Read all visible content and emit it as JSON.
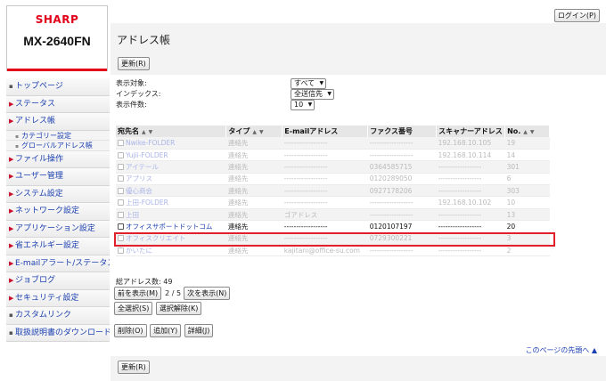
{
  "brand": {
    "logo": "SHARP",
    "model": "MX-2640FN"
  },
  "header": {
    "login_label": "ログイン(P)",
    "title": "アドレス帳",
    "refresh_label": "更新(R)"
  },
  "sidebar": {
    "items": [
      {
        "label": "トップページ",
        "marker": "gray"
      },
      {
        "label": "ステータス",
        "marker": "red"
      },
      {
        "label": "アドレス帳",
        "marker": "red"
      },
      {
        "label": "ファイル操作",
        "marker": "red"
      },
      {
        "label": "ユーザー管理",
        "marker": "red"
      },
      {
        "label": "システム設定",
        "marker": "red"
      },
      {
        "label": "ネットワーク設定",
        "marker": "red"
      },
      {
        "label": "アプリケーション設定",
        "marker": "red"
      },
      {
        "label": "省エネルギー設定",
        "marker": "red"
      },
      {
        "label": "E-mailアラート/ステータス",
        "marker": "red"
      },
      {
        "label": "ジョブログ",
        "marker": "red"
      },
      {
        "label": "セキュリティ設定",
        "marker": "red"
      },
      {
        "label": "カスタムリンク",
        "marker": "gray"
      },
      {
        "label": "取扱説明書のダウンロード",
        "marker": "gray"
      }
    ],
    "subitems": [
      {
        "label": "カテゴリー設定"
      },
      {
        "label": "グローバルアドレス帳"
      }
    ]
  },
  "filters": {
    "target_label": "表示対象:",
    "target_value": "すべて",
    "index_label": "インデックス:",
    "index_value": "全送信先",
    "count_label": "表示件数:",
    "count_value": "10"
  },
  "table": {
    "headers": {
      "name": "宛先名",
      "type": "タイプ",
      "email": "E-mailアドレス",
      "fax": "ファクス番号",
      "scanner": "スキャナーアドレス",
      "no": "No."
    },
    "rows": [
      {
        "name": "Nwike-FOLDER",
        "type": "連絡先",
        "email": "------------------",
        "fax": "------------------",
        "scanner": "192.168.10.105",
        "no": "19"
      },
      {
        "name": "Yujii-FOLDER",
        "type": "連絡先",
        "email": "------------------",
        "fax": "------------------",
        "scanner": "192.168.10.114",
        "no": "14"
      },
      {
        "name": "アイテール",
        "type": "連絡先",
        "email": "------------------",
        "fax": "0364585715",
        "scanner": "------------------",
        "no": "301"
      },
      {
        "name": "アプリス",
        "type": "連絡先",
        "email": "------------------",
        "fax": "0120289050",
        "scanner": "------------------",
        "no": "6"
      },
      {
        "name": "優心商会",
        "type": "連絡先",
        "email": "------------------",
        "fax": "0927178206",
        "scanner": "------------------",
        "no": "303"
      },
      {
        "name": "上田-FOLDER",
        "type": "連絡先",
        "email": "------------------",
        "fax": "------------------",
        "scanner": "192.168.10.102",
        "no": "10"
      },
      {
        "name": "上田",
        "type": "連絡先",
        "email": "ゴアドレス",
        "fax": "------------------",
        "scanner": "------------------",
        "no": "13"
      },
      {
        "name": "オフィスサポートドットコム",
        "type": "連絡先",
        "email": "------------------",
        "fax": "0120107197",
        "scanner": "------------------",
        "no": "20"
      },
      {
        "name": "オフィスクリエイト",
        "type": "連絡先",
        "email": "------------------",
        "fax": "0729300221",
        "scanner": "------------------",
        "no": "3"
      },
      {
        "name": "かいたに",
        "type": "連絡先",
        "email": "kajitani@office-su.com",
        "fax": "------------------",
        "scanner": "------------------",
        "no": "2"
      }
    ]
  },
  "pagination": {
    "total_label": "総アドレス数:",
    "total_value": "49",
    "prev_label": "前を表示(M)",
    "page_info": "2 / 5",
    "next_label": "次を表示(N)"
  },
  "selection": {
    "select_all": "全選択(S)",
    "deselect": "選択解除(K)"
  },
  "actions": {
    "delete": "削除(O)",
    "add": "追加(Y)",
    "detail": "詳細(J)"
  },
  "footer": {
    "page_top": "このページの先頭へ ▲",
    "refresh_label": "更新(R)"
  }
}
